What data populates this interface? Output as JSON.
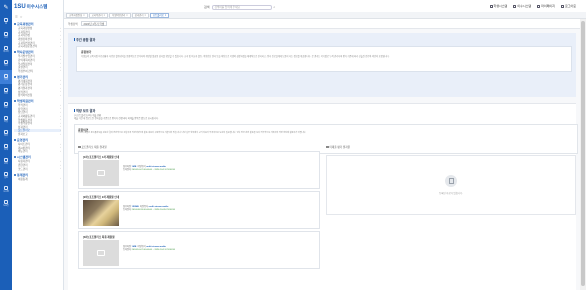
{
  "rail": {
    "logo": "✎",
    "items": [
      {
        "label": "홈",
        "icon": "home-icon"
      },
      {
        "label": "교과",
        "icon": "book-icon"
      },
      {
        "label": "비교과",
        "icon": "star-icon"
      },
      {
        "label": "학사",
        "icon": "cap-icon"
      },
      {
        "label": "학생",
        "icon": "user-icon"
      },
      {
        "label": "상담",
        "icon": "chat-icon"
      },
      {
        "label": "진로",
        "icon": "compass-icon"
      },
      {
        "label": "취업",
        "icon": "briefcase-icon"
      },
      {
        "label": "성과",
        "icon": "chart-icon"
      },
      {
        "label": "통계",
        "icon": "stats-icon"
      },
      {
        "label": "관리",
        "icon": "gear-icon"
      },
      {
        "label": "설정",
        "icon": "settings-icon"
      },
      {
        "label": "시스템",
        "icon": "system-icon"
      },
      {
        "label": "도움말",
        "icon": "help-icon"
      }
    ],
    "active_index": 4
  },
  "brand": {
    "mark": "1SU",
    "name": "이수시스템"
  },
  "sidebar": {
    "groups": [
      {
        "title": "교육과정관리",
        "items": [
          "교육과정편성",
          "교과목관리",
          "교과목편성",
          "개설강좌관리",
          "교과목변경관리",
          "교육과정운영관리"
        ]
      },
      {
        "title": "학사운영관리",
        "items": [
          "학기별수업관리",
          "강의계획서관리",
          "학사일정관리",
          "출결관리",
          "학점부여 관리"
        ]
      },
      {
        "title": "평가관리",
        "items": [
          "평가계획관리",
          "평가문항관리",
          "평가결과관리",
          "성적관리",
          "성적이의신청"
        ]
      },
      {
        "title": "학생지원관리",
        "items": [
          "학적관리",
          "장학관리",
          "상담관리",
          "교과외활동관리",
          "학생활동관리",
          "학생역량관리",
          "성과관리",
          "포트폴리오",
          "결과보고"
        ]
      },
      {
        "title": "운영관리",
        "items": [
          "사이트관리",
          "게시판관리",
          "메뉴관리"
        ]
      },
      {
        "title": "시스템관리",
        "items": [
          "사용자관리",
          "권한관리",
          "코드관리"
        ]
      },
      {
        "title": "통계관리",
        "items": [
          "이용통계"
        ]
      }
    ],
    "active_item": "포트폴리오"
  },
  "topbar": {
    "search_label": "검색",
    "search_placeholder": "검색어를 입력해 주세요",
    "links": [
      {
        "label": "학생시스템",
        "icon": "student-icon"
      },
      {
        "label": "이수시스템",
        "icon": "system-icon"
      },
      {
        "label": "마이페이지",
        "icon": "user-icon"
      },
      {
        "label": "로그아웃",
        "icon": "logout-icon"
      }
    ]
  },
  "tabs": [
    "교육과정편성",
    "교과목관리",
    "학생역량관리",
    "성과관리",
    "포트폴리오"
  ],
  "filter": {
    "label1": "학생검색",
    "value1": "2023년 1학기 학생",
    "btn_reset": "초기화",
    "btn_search": "조회"
  },
  "section1": {
    "title": "주간 종합 결과",
    "card_title": "종합평가",
    "card_body": "학생들의 교육과정 이수현황과 다양한 활동내역을 종합적으로 분석하여 개인별 맞춤형 성과를 확인할 수 있습니다. 교과 및 비교과 활동, 역량진단 결과 등을 바탕으로 학생의 성장과정을 체계적으로 관리하고, 향후 진로설계에 도움이 되는 정보를 제공합니다. 본 결과는 학기별로 누적 관리되며 평가 기준에 따라 산출된 점수와 의견이 포함됩니다."
  },
  "section2": {
    "title": "역량 보조 결과",
    "meta1": "[1] 포트폴리오(2차) 제출 현황",
    "meta2": "제출 기간 내 업로드된 결과물을 기준으로 평가가 진행되며, 미제출 항목은 별도로 표시됩니다.",
    "box_title": "종합의견",
    "box_body": "학생이 제출한 포트폴리오를 검토한 결과 전반적으로 성실하게 작성되었으며 활동 내용이 구체적으로 기술되어 있습니다. 다만 일부 항목에서 근거 자료가 부족하므로 보완이 필요합니다. 향후 전공 관련 활동을 보다 적극적으로 기록하여 역량 향상에 활용하기 바랍니다.",
    "left_header": "포트폴리오 제출 결과물",
    "right_header": "미제출 평가 결과물",
    "items": [
      {
        "title": "[1차] 포트폴리오 1차 제출물 안내",
        "has_image": false,
        "size_label": "첨부파일",
        "size": "1MB",
        "type_label": "파일형식",
        "type": "multi-stream-audio",
        "date_label": "등록일자",
        "date": "2024-10-07 00:00:00 ~ 2024-10-13 23:59:59"
      },
      {
        "title": "[2차] 포트폴리오 2차 제출물 안내",
        "has_image": true,
        "size_label": "첨부파일",
        "size": "150MB",
        "type_label": "파일형식",
        "type": "multi-stream-audio",
        "date_label": "등록일자",
        "date": "2024-09-19 00:00:00 ~ 2024-10-05 23:59:59"
      },
      {
        "title": "[3차] 포트폴리오 최종 제출물",
        "has_image": false,
        "size_label": "첨부파일",
        "size": "1MB",
        "type_label": "파일형식",
        "type": "multi-stream-audio",
        "date_label": "등록일자",
        "date": "2024-10-07 00:00:00 ~ 2024-10-13 23:59:59"
      }
    ],
    "empty_text": "등록된 자료가 없습니다."
  }
}
